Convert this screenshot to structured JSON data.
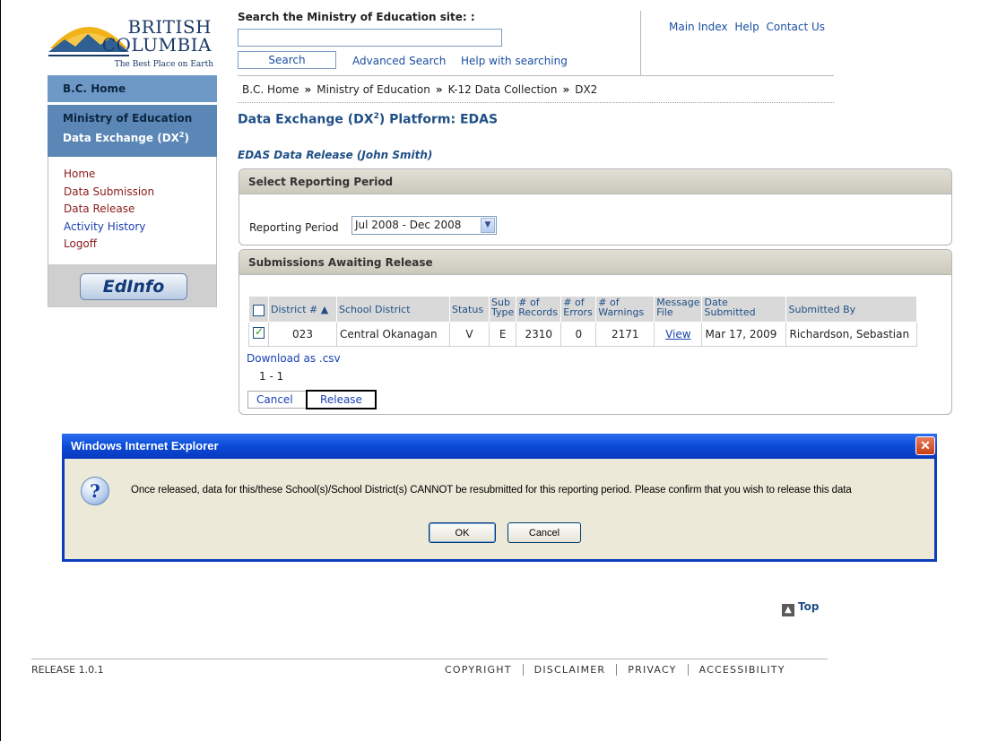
{
  "logo": {
    "line1": "BRITISH",
    "line2": "COLUMBIA",
    "tagline": "The Best Place on Earth"
  },
  "search": {
    "label": "Search the Ministry of Education site: :",
    "value": "",
    "button": "Search",
    "advanced": "Advanced Search",
    "help": "Help with searching"
  },
  "toplinks": [
    "Main Index",
    "Help",
    "Contact Us"
  ],
  "nav": {
    "home": "B.C. Home",
    "ministry": "Ministry of Education",
    "dx": "Data Exchange (DX",
    "dx_sup": "2",
    "dx_end": ")",
    "links": [
      {
        "label": "Home",
        "color": "#8b1a1a"
      },
      {
        "label": "Data Submission",
        "color": "#8b1a1a"
      },
      {
        "label": "Data Release",
        "color": "#8b1a1a"
      },
      {
        "label": "Activity History",
        "color": "#1a3fb0"
      },
      {
        "label": "Logoff",
        "color": "#8b1a1a"
      }
    ],
    "edinfo": "EdInfo"
  },
  "breadcrumb": [
    "B.C. Home",
    "Ministry of Education",
    "K-12 Data Collection",
    "DX2"
  ],
  "breadcrumb_sep": "»",
  "page": {
    "title_a": "Data Exchange (DX",
    "title_sup": "2",
    "title_b": ") Platform: EDAS",
    "subtitle": "EDAS Data Release (John Smith)"
  },
  "reporting": {
    "panel_title": "Select Reporting Period",
    "label": "Reporting Period",
    "selected": "Jul 2008 - Dec 2008"
  },
  "submissions": {
    "panel_title": "Submissions Awaiting Release",
    "columns": {
      "district": "District #",
      "school_district": "School District",
      "status": "Status",
      "sub_type_1": "Sub",
      "sub_type_2": "Type",
      "records_1": "# of",
      "records_2": "Records",
      "errors_1": "# of",
      "errors_2": "Errors",
      "warnings_1": "# of",
      "warnings_2": "Warnings",
      "message_1": "Message",
      "message_2": "File",
      "date_1": "Date",
      "date_2": "Submitted",
      "submitted_by": "Submitted By"
    },
    "rows": [
      {
        "checked": true,
        "district": "023",
        "school_district": "Central Okanagan",
        "status": "V",
        "sub_type": "E",
        "records": "2310",
        "errors": "0",
        "warnings": "2171",
        "message_file": "View",
        "date": "Mar 17, 2009",
        "submitted_by": "Richardson, Sebastian"
      }
    ],
    "download": "Download as .csv",
    "pager": "1 - 1",
    "cancel": "Cancel",
    "release": "Release"
  },
  "dialog": {
    "title": "Windows Internet Explorer",
    "close": "✕",
    "icon": "question-icon",
    "message": "Once released, data for this/these School(s)/School District(s) CANNOT be resubmitted for this reporting period. Please confirm that you wish to release this data",
    "ok": "OK",
    "cancel": "Cancel"
  },
  "footer": {
    "top": "Top",
    "release": "RELEASE 1.0.1",
    "links": [
      "COPYRIGHT",
      "DISCLAIMER",
      "PRIVACY",
      "ACCESSIBILITY"
    ]
  },
  "colors": {
    "nav_home_bg": "#6e99c7",
    "nav_ministry_bg": "#5a87b6",
    "title_blue": "#1f4f86",
    "dialog_title": "#0b4ad6"
  }
}
